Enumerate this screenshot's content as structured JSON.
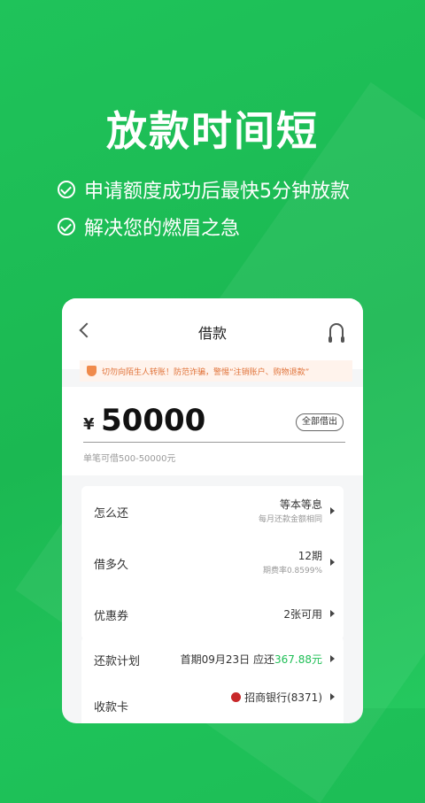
{
  "hero": {
    "title": "放款时间短",
    "bullets": [
      "申请额度成功后最快5分钟放款",
      "解决您的燃眉之急"
    ]
  },
  "phone": {
    "header": {
      "title": "借款"
    },
    "notice": "切勿向陌生人转账！防范诈骗，警惕“注销账户、购物退款”",
    "amount": {
      "currency": "¥",
      "value": "50000",
      "all_button": "全部借出",
      "hint": "单笔可借500-50000元"
    },
    "options": [
      {
        "label": "怎么还",
        "value": "等本等息",
        "sub": "每月还款金额相同"
      },
      {
        "label": "借多久",
        "value": "12期",
        "sub": "期费率0.8599%"
      },
      {
        "label": "优惠券",
        "value": "2张可用",
        "sub": ""
      }
    ],
    "repayment": {
      "label": "还款计划",
      "prefix": "首期09月23日 应还",
      "amount": "367.88元"
    },
    "receive": {
      "label": "收款卡",
      "bank": "招商银行(8371)"
    }
  },
  "colors": {
    "primary_green": "#1fbf56",
    "notice_orange": "#e0733a"
  }
}
